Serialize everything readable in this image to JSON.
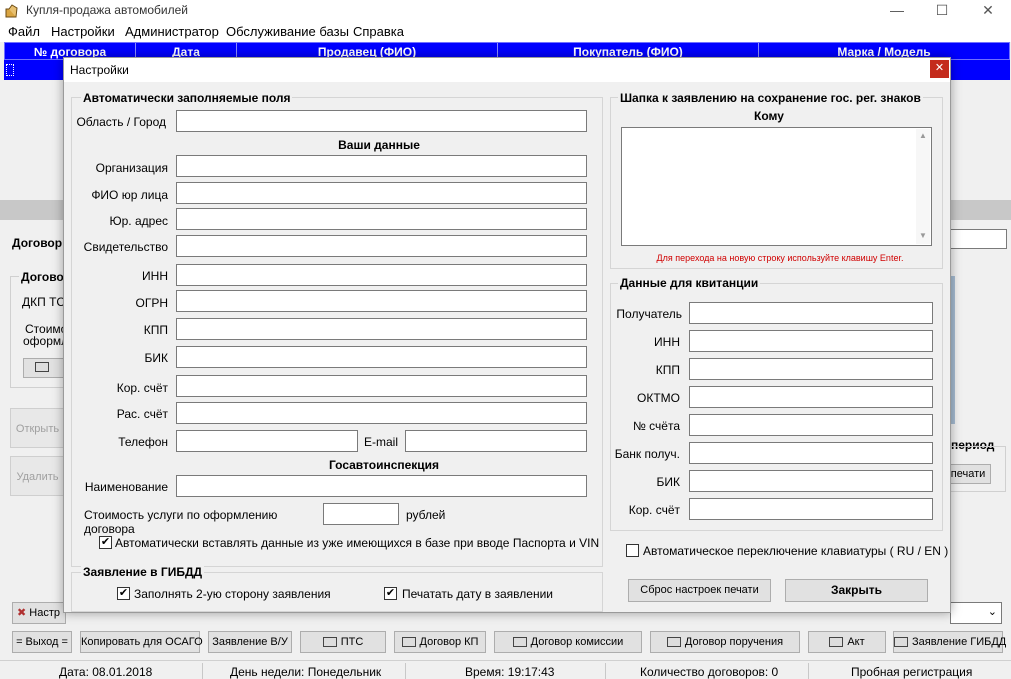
{
  "window": {
    "title": "Купля-продажа автомобилей"
  },
  "menu": [
    "Файл",
    "Настройки",
    "Администратор",
    "Обслуживание базы",
    "Справка"
  ],
  "grid": {
    "columns": [
      "№ договора",
      "Дата",
      "Продавец (ФИО)",
      "Покупатель (ФИО)",
      "Марка / Модель"
    ]
  },
  "background": {
    "contract_label": "Договор",
    "contract_group_label": "Договор",
    "dkp_label": "ДКП ТС",
    "cost_label_1": "Стоимо",
    "cost_label_2": "оформле",
    "open_button": "Открыть",
    "delete_button": "Удалить",
    "period_label": "период",
    "print_button": "печати",
    "settings_button": "Настр"
  },
  "bottom_buttons": [
    "= Выход =",
    "Копировать для ОСАГО",
    "Заявление В/У",
    "ПТС",
    "Договор КП",
    "Договор комиссии",
    "Договор поручения",
    "Акт",
    "Заявление ГИБДД"
  ],
  "status": {
    "date": "Дата: 08.01.2018",
    "weekday": "День недели: Понедельник",
    "time": "Время: 19:17:43",
    "count": "Количество договоров: 0",
    "registration": "Пробная регистрация"
  },
  "dialog": {
    "title": "Настройки",
    "close_icon": "close-icon",
    "auto_group": {
      "legend": "Автоматически заполняемые поля",
      "region_label": "Область / Город",
      "region_value": "",
      "your_data": "Ваши данные",
      "fields": [
        {
          "label": "Организация",
          "value": ""
        },
        {
          "label": "ФИО юр лица",
          "value": ""
        },
        {
          "label": "Юр. адрес",
          "value": ""
        },
        {
          "label": "Свидетельство",
          "value": ""
        },
        {
          "label": "ИНН",
          "value": ""
        },
        {
          "label": "ОГРН",
          "value": ""
        },
        {
          "label": "КПП",
          "value": ""
        },
        {
          "label": "БИК",
          "value": ""
        },
        {
          "label": "Кор. счёт",
          "value": ""
        },
        {
          "label": "Рас. счёт",
          "value": ""
        }
      ],
      "phone_label": "Телефон",
      "phone_value": "",
      "email_label": "E-mail",
      "email_value": "",
      "gai_section": "Госавтоинспекция",
      "name_label": "Наименование",
      "name_value": "",
      "cost_label": "Стоимость услуги по оформлению договора",
      "cost_value": "",
      "cost_unit": "рублей",
      "autofill_label": "Автоматически вставлять данные из уже имеющихся в базе при вводе Паспорта и VIN",
      "autofill_checked": true
    },
    "gibdd_group": {
      "legend": "Заявление в ГИБДД",
      "fill_second_side": "Заполнять 2-ую сторону заявления",
      "fill_second_side_checked": true,
      "print_date": "Печатать дату в заявлении",
      "print_date_checked": true
    },
    "header_group": {
      "legend": "Шапка к заявлению на сохранение гос. рег. знаков",
      "to_label": "Кому",
      "to_value": "",
      "hint": "Для перехода на новую строку используйте клавишу Enter."
    },
    "receipt_group": {
      "legend": "Данные для квитанции",
      "fields": [
        {
          "label": "Получатель",
          "value": ""
        },
        {
          "label": "ИНН",
          "value": ""
        },
        {
          "label": "КПП",
          "value": ""
        },
        {
          "label": "ОКТМО",
          "value": ""
        },
        {
          "label": "№ счёта",
          "value": ""
        },
        {
          "label": "Банк получ.",
          "value": ""
        },
        {
          "label": "БИК",
          "value": ""
        },
        {
          "label": "Кор. счёт",
          "value": ""
        }
      ]
    },
    "keyboard_switch_label": "Автоматическое переключение клавиатуры ( RU / EN )",
    "keyboard_switch_checked": false,
    "reset_print_button": "Сброс настроек печати",
    "close_button": "Закрыть"
  },
  "colors": {
    "grid_header": "#0000ff",
    "hint_text": "#d00000",
    "close_red": "#c42b1c"
  }
}
